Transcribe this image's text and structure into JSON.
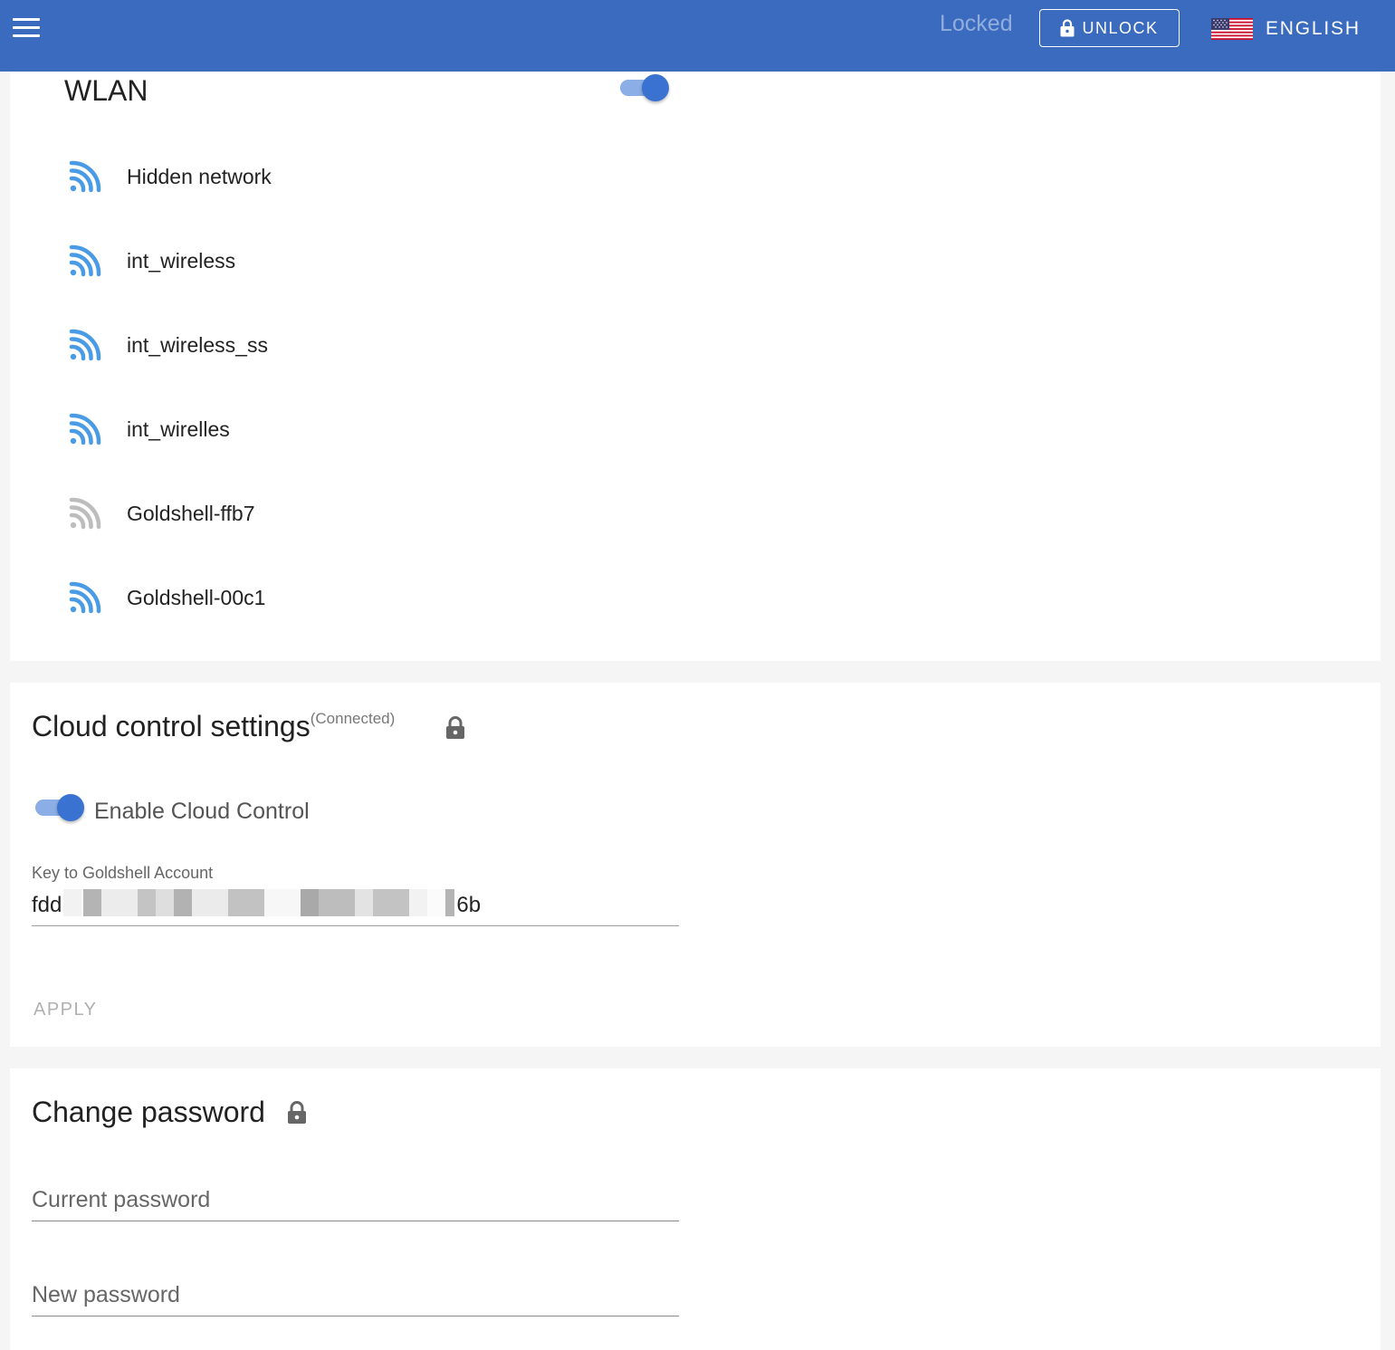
{
  "topbar": {
    "status": "Locked",
    "unlock_label": "UNLOCK",
    "language_label": "ENGLISH",
    "accent_color": "#3a6bbf"
  },
  "wlan": {
    "title": "WLAN",
    "enabled": true,
    "networks": [
      {
        "name": "Hidden network",
        "signal": "strong",
        "icon": "wifi-icon"
      },
      {
        "name": "int_wireless",
        "signal": "strong",
        "icon": "wifi-icon"
      },
      {
        "name": "int_wireless_ss",
        "signal": "strong",
        "icon": "wifi-icon"
      },
      {
        "name": "int_wirelles",
        "signal": "strong",
        "icon": "wifi-icon"
      },
      {
        "name": "Goldshell-ffb7",
        "signal": "weak",
        "icon": "wifi-icon"
      },
      {
        "name": "Goldshell-00c1",
        "signal": "strong",
        "icon": "wifi-icon"
      }
    ],
    "signal_colors": {
      "strong": "#4a9be6",
      "weak": "#bdbdbd"
    }
  },
  "cloud": {
    "title": "Cloud control settings",
    "status": "(Connected)",
    "enable_label": "Enable Cloud Control",
    "enabled": true,
    "key_label": "Key to Goldshell Account",
    "key_prefix": "fdd",
    "key_suffix": "6b",
    "apply_label": "APPLY"
  },
  "password": {
    "title": "Change password",
    "current_placeholder": "Current password",
    "new_placeholder": "New password"
  }
}
